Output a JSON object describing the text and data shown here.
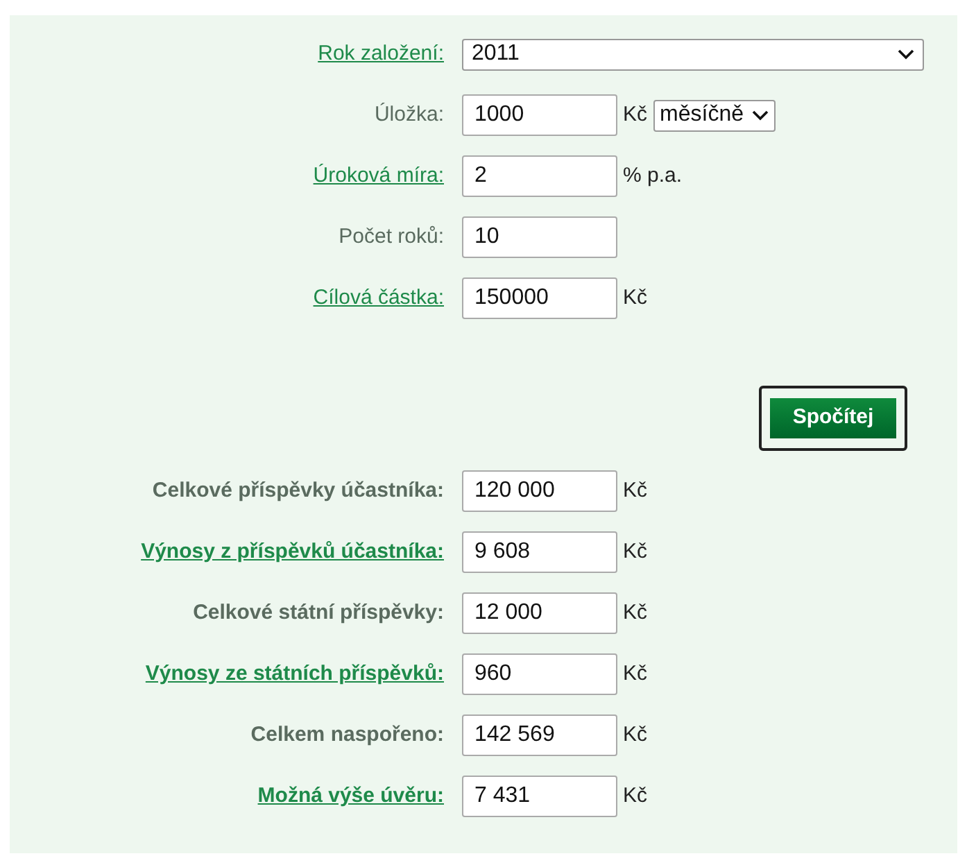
{
  "inputs": [
    {
      "label": "Rok založení:",
      "linked": true,
      "kind": "select",
      "value": "2011"
    },
    {
      "label": "Úložka:",
      "linked": false,
      "kind": "text",
      "value": "1000",
      "unit": "Kč",
      "period": "měsíčně"
    },
    {
      "label": "Úroková míra:",
      "linked": true,
      "kind": "text",
      "value": "2",
      "unit": "% p.a."
    },
    {
      "label": "Počet roků:",
      "linked": false,
      "kind": "text",
      "value": "10"
    },
    {
      "label": "Cílová částka:",
      "linked": true,
      "kind": "text",
      "value": "150000",
      "unit": "Kč"
    }
  ],
  "button": "Spočítej",
  "results": [
    {
      "label": "Celkové příspěvky účastníka:",
      "linked": false,
      "value": "120 000",
      "unit": "Kč"
    },
    {
      "label": "Výnosy z příspěvků účastníka:",
      "linked": true,
      "value": "9 608",
      "unit": "Kč"
    },
    {
      "label": "Celkové státní příspěvky:",
      "linked": false,
      "value": "12 000",
      "unit": "Kč"
    },
    {
      "label": "Výnosy ze státních příspěvků:",
      "linked": true,
      "value": "960",
      "unit": "Kč"
    },
    {
      "label": "Celkem naspořeno:",
      "linked": false,
      "value": "142 569",
      "unit": "Kč"
    },
    {
      "label": "Možná výše úvěru:",
      "linked": true,
      "value": "7 431",
      "unit": "Kč"
    }
  ]
}
